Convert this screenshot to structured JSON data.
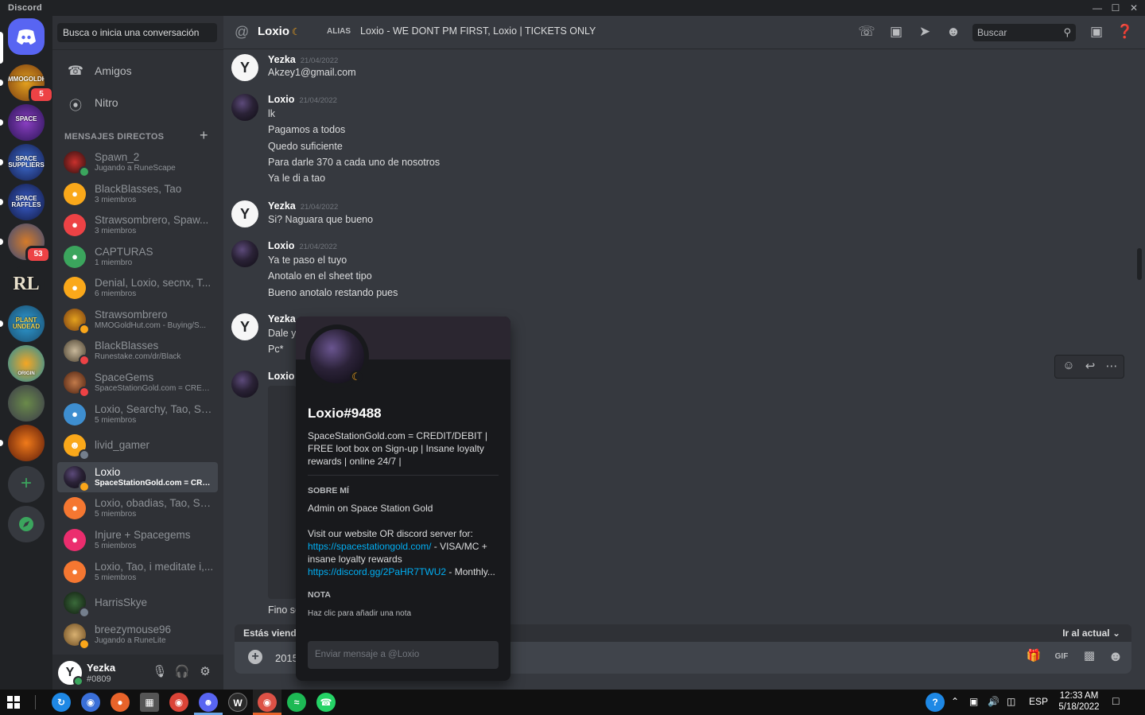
{
  "window": {
    "brand": "Discord"
  },
  "servers": [
    {
      "name": "discord-home",
      "label": "",
      "badge": ""
    },
    {
      "name": "mmogoldhut",
      "label": "MMOGOLDHUT",
      "badge": "5"
    },
    {
      "name": "space-station",
      "label": "SPACE",
      "badge": ""
    },
    {
      "name": "space-suppliers",
      "label": "SPACE SUPPLIERS",
      "badge": ""
    },
    {
      "name": "space-raffles",
      "label": "SPACE RAFFLES",
      "badge": ""
    },
    {
      "name": "server-runescape",
      "label": "",
      "badge": "53"
    },
    {
      "name": "runelite",
      "label": "RL",
      "badge": ""
    },
    {
      "name": "plants-undead",
      "label": "PLANT UNDEAD",
      "badge": ""
    },
    {
      "name": "origin",
      "label": "ORIGIN",
      "badge": ""
    },
    {
      "name": "frog",
      "label": "",
      "badge": ""
    },
    {
      "name": "pumpkin",
      "label": "",
      "badge": ""
    }
  ],
  "dm_sidebar": {
    "search_placeholder": "Busca o inicia una conversación",
    "friends_label": "Amigos",
    "nitro_label": "Nitro",
    "header": "MENSAJES DIRECTOS",
    "items": [
      {
        "name": "Spawn_2",
        "sub": "Jugando a RuneScape"
      },
      {
        "name": "BlackBlasses, Tao",
        "sub": "3 miembros"
      },
      {
        "name": "Strawsombrero, Spaw...",
        "sub": "3 miembros"
      },
      {
        "name": "CAPTURAS",
        "sub": "1 miembro"
      },
      {
        "name": "Denial, Loxio, secnx, T...",
        "sub": "6 miembros"
      },
      {
        "name": "Strawsombrero",
        "sub": "MMOGoldHut.com - Buying/S..."
      },
      {
        "name": "BlackBlasses",
        "sub": "Runestake.com/dr/Black"
      },
      {
        "name": "SpaceGems",
        "sub": "SpaceStationGold.com = CRED..."
      },
      {
        "name": "Loxio, Searchy, Tao, Sp...",
        "sub": "5 miembros"
      },
      {
        "name": "livid_gamer",
        "sub": ""
      },
      {
        "name": "Loxio",
        "sub": "SpaceStationGold.com = CRED..."
      },
      {
        "name": "Loxio, obadias, Tao, Sp...",
        "sub": "5 miembros"
      },
      {
        "name": "Injure + Spacegems",
        "sub": "5 miembros"
      },
      {
        "name": "Loxio, Tao, i meditate i,...",
        "sub": "5 miembros"
      },
      {
        "name": "HarrisSkye",
        "sub": ""
      },
      {
        "name": "breezymouse96",
        "sub": "Jugando a RuneLite"
      }
    ]
  },
  "user_panel": {
    "username": "Yezka",
    "tag": "#0809"
  },
  "channel": {
    "name": "Loxio",
    "alias_label": "ALIAS",
    "alias_value": "Loxio - WE DONT PM FIRST, Loxio | TICKETS ONLY",
    "search_placeholder": "Buscar"
  },
  "messages": [
    {
      "author": "Yezka",
      "time": "21/04/2022",
      "lines": [
        "Akzey1@gmail.com"
      ]
    },
    {
      "author": "Loxio",
      "time": "21/04/2022",
      "lines": [
        "lk",
        "Pagamos a todos",
        "Quedo suficiente",
        "Para darle 370 a cada uno de nosotros",
        "Ya le di a tao"
      ]
    },
    {
      "author": "Yezka",
      "time": "21/04/2022",
      "lines": [
        "Si? Naguara que bueno"
      ]
    },
    {
      "author": "Loxio",
      "time": "21/04/2022",
      "lines": [
        "Ya te paso el tuyo",
        "Anotalo en el sheet tipo",
        "Bueno anotalo restando pues"
      ]
    },
    {
      "author": "Yezka",
      "time": "",
      "lines": [
        "Dale y",
        "Pc*"
      ]
    },
    {
      "author": "Loxio",
      "time": "",
      "lines": [
        "Fino se"
      ]
    }
  ],
  "composer": {
    "viewing_label": "Estás viendo",
    "jump_label": "Ir al actual",
    "draft_text": "2015"
  },
  "profile": {
    "name": "Loxio",
    "discriminator": "#9488",
    "custom_status": "SpaceStationGold.com = CREDIT/DEBIT | FREE loot box on Sign-up | Insane loyalty rewards | online 24/7 |",
    "about_header": "SOBRE MÍ",
    "about_line1": "Admin on Space Station Gold",
    "about_line2": "Visit our website OR discord server for:",
    "link1": "https://spacestationgold.com/",
    "link1_after": " - VISA/MC +",
    "about_line3": "insane loyalty rewards",
    "link2": "https://discord.gg/2PaHR7TWU2",
    "link2_after": " - Monthly...",
    "note_header": "NOTA",
    "note_placeholder": "Haz clic para añadir una nota",
    "message_placeholder": "Enviar mensaje a @Loxio"
  },
  "taskbar": {
    "language": "ESP",
    "time": "12:33 AM",
    "date": "5/18/2022"
  }
}
